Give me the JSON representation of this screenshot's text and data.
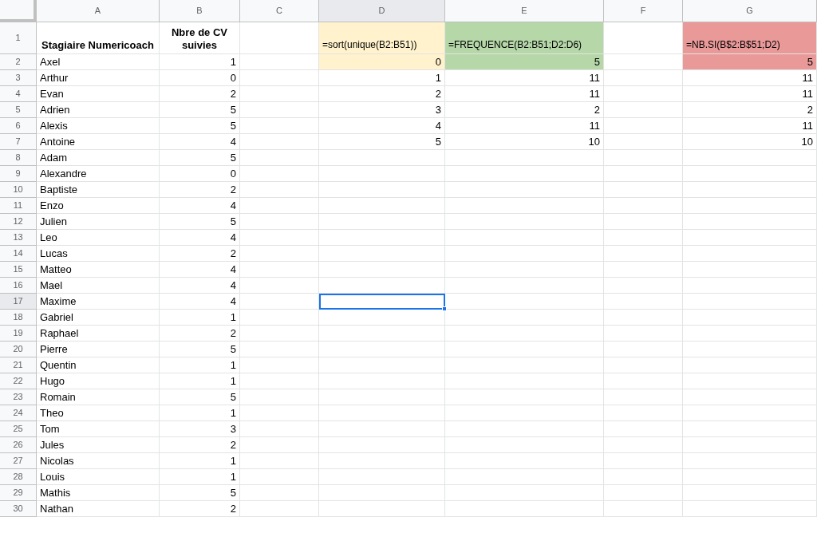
{
  "columns": [
    {
      "label": "A",
      "selected": false
    },
    {
      "label": "B",
      "selected": false
    },
    {
      "label": "C",
      "selected": false
    },
    {
      "label": "D",
      "selected": true
    },
    {
      "label": "E",
      "selected": false
    },
    {
      "label": "F",
      "selected": false
    },
    {
      "label": "G",
      "selected": false
    }
  ],
  "rows": [
    {
      "number": "1",
      "selected": false,
      "cells": [
        {
          "kind": "header",
          "text": "Stagiaire Numericoach"
        },
        {
          "kind": "header",
          "text": "Nbre de CV suivies"
        },
        null,
        {
          "kind": "formula",
          "text": "=sort(unique(B2:B51))",
          "color": "#fff2cc"
        },
        {
          "kind": "formula",
          "text": "=FREQUENCE(B2:B51;D2:D6)",
          "color": "#b6d7a8"
        },
        null,
        {
          "kind": "formula",
          "text": "=NB.SI(B$2:B$51;D2)",
          "color": "#ea9999"
        }
      ]
    },
    {
      "number": "2",
      "selected": false,
      "cells": [
        {
          "kind": "text",
          "text": "Axel"
        },
        {
          "kind": "number",
          "text": "1"
        },
        null,
        {
          "kind": "number",
          "text": "0",
          "color": "#fff2cc"
        },
        {
          "kind": "number",
          "text": "5",
          "color": "#b6d7a8"
        },
        null,
        {
          "kind": "number",
          "text": "5",
          "color": "#ea9999"
        }
      ]
    },
    {
      "number": "3",
      "selected": false,
      "cells": [
        {
          "kind": "text",
          "text": "Arthur"
        },
        {
          "kind": "number",
          "text": "0"
        },
        null,
        {
          "kind": "number",
          "text": "1"
        },
        {
          "kind": "number",
          "text": "11"
        },
        null,
        {
          "kind": "number",
          "text": "11"
        }
      ]
    },
    {
      "number": "4",
      "selected": false,
      "cells": [
        {
          "kind": "text",
          "text": "Evan"
        },
        {
          "kind": "number",
          "text": "2"
        },
        null,
        {
          "kind": "number",
          "text": "2"
        },
        {
          "kind": "number",
          "text": "11"
        },
        null,
        {
          "kind": "number",
          "text": "11"
        }
      ]
    },
    {
      "number": "5",
      "selected": false,
      "cells": [
        {
          "kind": "text",
          "text": "Adrien"
        },
        {
          "kind": "number",
          "text": "5"
        },
        null,
        {
          "kind": "number",
          "text": "3"
        },
        {
          "kind": "number",
          "text": "2"
        },
        null,
        {
          "kind": "number",
          "text": "2"
        }
      ]
    },
    {
      "number": "6",
      "selected": false,
      "cells": [
        {
          "kind": "text",
          "text": "Alexis"
        },
        {
          "kind": "number",
          "text": "5"
        },
        null,
        {
          "kind": "number",
          "text": "4"
        },
        {
          "kind": "number",
          "text": "11"
        },
        null,
        {
          "kind": "number",
          "text": "11"
        }
      ]
    },
    {
      "number": "7",
      "selected": false,
      "cells": [
        {
          "kind": "text",
          "text": "Antoine"
        },
        {
          "kind": "number",
          "text": "4"
        },
        null,
        {
          "kind": "number",
          "text": "5"
        },
        {
          "kind": "number",
          "text": "10"
        },
        null,
        {
          "kind": "number",
          "text": "10"
        }
      ]
    },
    {
      "number": "8",
      "selected": false,
      "cells": [
        {
          "kind": "text",
          "text": "Adam"
        },
        {
          "kind": "number",
          "text": "5"
        }
      ]
    },
    {
      "number": "9",
      "selected": false,
      "cells": [
        {
          "kind": "text",
          "text": "Alexandre"
        },
        {
          "kind": "number",
          "text": "0"
        }
      ]
    },
    {
      "number": "10",
      "selected": false,
      "cells": [
        {
          "kind": "text",
          "text": "Baptiste"
        },
        {
          "kind": "number",
          "text": "2"
        }
      ]
    },
    {
      "number": "11",
      "selected": false,
      "cells": [
        {
          "kind": "text",
          "text": "Enzo"
        },
        {
          "kind": "number",
          "text": "4"
        }
      ]
    },
    {
      "number": "12",
      "selected": false,
      "cells": [
        {
          "kind": "text",
          "text": "Julien"
        },
        {
          "kind": "number",
          "text": "5"
        }
      ]
    },
    {
      "number": "13",
      "selected": false,
      "cells": [
        {
          "kind": "text",
          "text": "Leo"
        },
        {
          "kind": "number",
          "text": "4"
        }
      ]
    },
    {
      "number": "14",
      "selected": false,
      "cells": [
        {
          "kind": "text",
          "text": "Lucas"
        },
        {
          "kind": "number",
          "text": "2"
        }
      ]
    },
    {
      "number": "15",
      "selected": false,
      "cells": [
        {
          "kind": "text",
          "text": "Matteo"
        },
        {
          "kind": "number",
          "text": "4"
        }
      ]
    },
    {
      "number": "16",
      "selected": false,
      "cells": [
        {
          "kind": "text",
          "text": "Mael"
        },
        {
          "kind": "number",
          "text": "4"
        }
      ]
    },
    {
      "number": "17",
      "selected": true,
      "cells": [
        {
          "kind": "text",
          "text": "Maxime"
        },
        {
          "kind": "number",
          "text": "4"
        },
        null,
        {
          "kind": "empty",
          "selected": true
        }
      ]
    },
    {
      "number": "18",
      "selected": false,
      "cells": [
        {
          "kind": "text",
          "text": "Gabriel"
        },
        {
          "kind": "number",
          "text": "1"
        }
      ]
    },
    {
      "number": "19",
      "selected": false,
      "cells": [
        {
          "kind": "text",
          "text": "Raphael"
        },
        {
          "kind": "number",
          "text": "2"
        }
      ]
    },
    {
      "number": "20",
      "selected": false,
      "cells": [
        {
          "kind": "text",
          "text": "Pierre"
        },
        {
          "kind": "number",
          "text": "5"
        }
      ]
    },
    {
      "number": "21",
      "selected": false,
      "cells": [
        {
          "kind": "text",
          "text": "Quentin"
        },
        {
          "kind": "number",
          "text": "1"
        }
      ]
    },
    {
      "number": "22",
      "selected": false,
      "cells": [
        {
          "kind": "text",
          "text": "Hugo"
        },
        {
          "kind": "number",
          "text": "1"
        }
      ]
    },
    {
      "number": "23",
      "selected": false,
      "cells": [
        {
          "kind": "text",
          "text": "Romain"
        },
        {
          "kind": "number",
          "text": "5"
        }
      ]
    },
    {
      "number": "24",
      "selected": false,
      "cells": [
        {
          "kind": "text",
          "text": "Theo"
        },
        {
          "kind": "number",
          "text": "1"
        }
      ]
    },
    {
      "number": "25",
      "selected": false,
      "cells": [
        {
          "kind": "text",
          "text": "Tom"
        },
        {
          "kind": "number",
          "text": "3"
        }
      ]
    },
    {
      "number": "26",
      "selected": false,
      "cells": [
        {
          "kind": "text",
          "text": "Jules"
        },
        {
          "kind": "number",
          "text": "2"
        }
      ]
    },
    {
      "number": "27",
      "selected": false,
      "cells": [
        {
          "kind": "text",
          "text": "Nicolas"
        },
        {
          "kind": "number",
          "text": "1"
        }
      ]
    },
    {
      "number": "28",
      "selected": false,
      "cells": [
        {
          "kind": "text",
          "text": "Louis"
        },
        {
          "kind": "number",
          "text": "1"
        }
      ]
    },
    {
      "number": "29",
      "selected": false,
      "cells": [
        {
          "kind": "text",
          "text": "Mathis"
        },
        {
          "kind": "number",
          "text": "5"
        }
      ]
    },
    {
      "number": "30",
      "selected": false,
      "cells": [
        {
          "kind": "text",
          "text": "Nathan"
        },
        {
          "kind": "number",
          "text": "2"
        }
      ]
    }
  ]
}
